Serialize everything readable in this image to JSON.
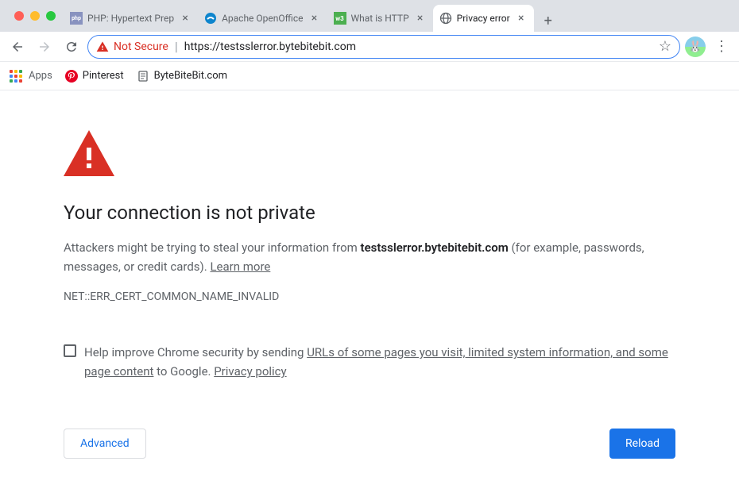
{
  "tabs": [
    {
      "title": "PHP: Hypertext Prep",
      "favicon": "php"
    },
    {
      "title": "Apache OpenOffice",
      "favicon": "seagull"
    },
    {
      "title": "What is HTTP",
      "favicon": "w3"
    },
    {
      "title": "Privacy error",
      "favicon": "globe",
      "active": true
    }
  ],
  "toolbar": {
    "not_secure": "Not Secure",
    "url": "https://testsslerror.bytebitebit.com"
  },
  "bookmarks": {
    "apps": "Apps",
    "items": [
      {
        "label": "Pinterest",
        "icon": "pinterest"
      },
      {
        "label": "ByteBiteBit.com",
        "icon": "page"
      }
    ]
  },
  "error": {
    "heading": "Your connection is not private",
    "desc_prefix": "Attackers might be trying to steal your information from ",
    "desc_domain": "testsslerror.bytebitebit.com",
    "desc_suffix": " (for example, passwords, messages, or credit cards). ",
    "learn_more": "Learn more",
    "code": "NET::ERR_CERT_COMMON_NAME_INVALID",
    "checkbox_prefix": "Help improve Chrome security by sending ",
    "checkbox_link1": "URLs of some pages you visit, limited system information, and some page content",
    "checkbox_mid": " to Google. ",
    "checkbox_link2": "Privacy policy",
    "advanced": "Advanced",
    "reload": "Reload"
  }
}
